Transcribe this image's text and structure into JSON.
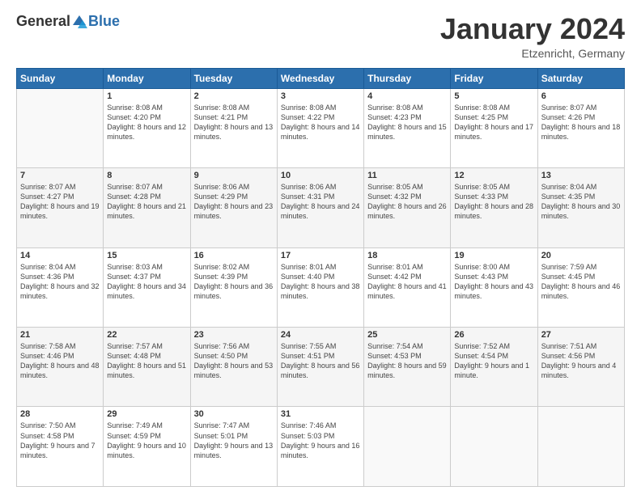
{
  "logo": {
    "general": "General",
    "blue": "Blue"
  },
  "header": {
    "month": "January 2024",
    "location": "Etzenricht, Germany"
  },
  "days_of_week": [
    "Sunday",
    "Monday",
    "Tuesday",
    "Wednesday",
    "Thursday",
    "Friday",
    "Saturday"
  ],
  "weeks": [
    [
      {
        "num": "",
        "sunrise": "",
        "sunset": "",
        "daylight": ""
      },
      {
        "num": "1",
        "sunrise": "Sunrise: 8:08 AM",
        "sunset": "Sunset: 4:20 PM",
        "daylight": "Daylight: 8 hours and 12 minutes."
      },
      {
        "num": "2",
        "sunrise": "Sunrise: 8:08 AM",
        "sunset": "Sunset: 4:21 PM",
        "daylight": "Daylight: 8 hours and 13 minutes."
      },
      {
        "num": "3",
        "sunrise": "Sunrise: 8:08 AM",
        "sunset": "Sunset: 4:22 PM",
        "daylight": "Daylight: 8 hours and 14 minutes."
      },
      {
        "num": "4",
        "sunrise": "Sunrise: 8:08 AM",
        "sunset": "Sunset: 4:23 PM",
        "daylight": "Daylight: 8 hours and 15 minutes."
      },
      {
        "num": "5",
        "sunrise": "Sunrise: 8:08 AM",
        "sunset": "Sunset: 4:25 PM",
        "daylight": "Daylight: 8 hours and 17 minutes."
      },
      {
        "num": "6",
        "sunrise": "Sunrise: 8:07 AM",
        "sunset": "Sunset: 4:26 PM",
        "daylight": "Daylight: 8 hours and 18 minutes."
      }
    ],
    [
      {
        "num": "7",
        "sunrise": "Sunrise: 8:07 AM",
        "sunset": "Sunset: 4:27 PM",
        "daylight": "Daylight: 8 hours and 19 minutes."
      },
      {
        "num": "8",
        "sunrise": "Sunrise: 8:07 AM",
        "sunset": "Sunset: 4:28 PM",
        "daylight": "Daylight: 8 hours and 21 minutes."
      },
      {
        "num": "9",
        "sunrise": "Sunrise: 8:06 AM",
        "sunset": "Sunset: 4:29 PM",
        "daylight": "Daylight: 8 hours and 23 minutes."
      },
      {
        "num": "10",
        "sunrise": "Sunrise: 8:06 AM",
        "sunset": "Sunset: 4:31 PM",
        "daylight": "Daylight: 8 hours and 24 minutes."
      },
      {
        "num": "11",
        "sunrise": "Sunrise: 8:05 AM",
        "sunset": "Sunset: 4:32 PM",
        "daylight": "Daylight: 8 hours and 26 minutes."
      },
      {
        "num": "12",
        "sunrise": "Sunrise: 8:05 AM",
        "sunset": "Sunset: 4:33 PM",
        "daylight": "Daylight: 8 hours and 28 minutes."
      },
      {
        "num": "13",
        "sunrise": "Sunrise: 8:04 AM",
        "sunset": "Sunset: 4:35 PM",
        "daylight": "Daylight: 8 hours and 30 minutes."
      }
    ],
    [
      {
        "num": "14",
        "sunrise": "Sunrise: 8:04 AM",
        "sunset": "Sunset: 4:36 PM",
        "daylight": "Daylight: 8 hours and 32 minutes."
      },
      {
        "num": "15",
        "sunrise": "Sunrise: 8:03 AM",
        "sunset": "Sunset: 4:37 PM",
        "daylight": "Daylight: 8 hours and 34 minutes."
      },
      {
        "num": "16",
        "sunrise": "Sunrise: 8:02 AM",
        "sunset": "Sunset: 4:39 PM",
        "daylight": "Daylight: 8 hours and 36 minutes."
      },
      {
        "num": "17",
        "sunrise": "Sunrise: 8:01 AM",
        "sunset": "Sunset: 4:40 PM",
        "daylight": "Daylight: 8 hours and 38 minutes."
      },
      {
        "num": "18",
        "sunrise": "Sunrise: 8:01 AM",
        "sunset": "Sunset: 4:42 PM",
        "daylight": "Daylight: 8 hours and 41 minutes."
      },
      {
        "num": "19",
        "sunrise": "Sunrise: 8:00 AM",
        "sunset": "Sunset: 4:43 PM",
        "daylight": "Daylight: 8 hours and 43 minutes."
      },
      {
        "num": "20",
        "sunrise": "Sunrise: 7:59 AM",
        "sunset": "Sunset: 4:45 PM",
        "daylight": "Daylight: 8 hours and 46 minutes."
      }
    ],
    [
      {
        "num": "21",
        "sunrise": "Sunrise: 7:58 AM",
        "sunset": "Sunset: 4:46 PM",
        "daylight": "Daylight: 8 hours and 48 minutes."
      },
      {
        "num": "22",
        "sunrise": "Sunrise: 7:57 AM",
        "sunset": "Sunset: 4:48 PM",
        "daylight": "Daylight: 8 hours and 51 minutes."
      },
      {
        "num": "23",
        "sunrise": "Sunrise: 7:56 AM",
        "sunset": "Sunset: 4:50 PM",
        "daylight": "Daylight: 8 hours and 53 minutes."
      },
      {
        "num": "24",
        "sunrise": "Sunrise: 7:55 AM",
        "sunset": "Sunset: 4:51 PM",
        "daylight": "Daylight: 8 hours and 56 minutes."
      },
      {
        "num": "25",
        "sunrise": "Sunrise: 7:54 AM",
        "sunset": "Sunset: 4:53 PM",
        "daylight": "Daylight: 8 hours and 59 minutes."
      },
      {
        "num": "26",
        "sunrise": "Sunrise: 7:52 AM",
        "sunset": "Sunset: 4:54 PM",
        "daylight": "Daylight: 9 hours and 1 minute."
      },
      {
        "num": "27",
        "sunrise": "Sunrise: 7:51 AM",
        "sunset": "Sunset: 4:56 PM",
        "daylight": "Daylight: 9 hours and 4 minutes."
      }
    ],
    [
      {
        "num": "28",
        "sunrise": "Sunrise: 7:50 AM",
        "sunset": "Sunset: 4:58 PM",
        "daylight": "Daylight: 9 hours and 7 minutes."
      },
      {
        "num": "29",
        "sunrise": "Sunrise: 7:49 AM",
        "sunset": "Sunset: 4:59 PM",
        "daylight": "Daylight: 9 hours and 10 minutes."
      },
      {
        "num": "30",
        "sunrise": "Sunrise: 7:47 AM",
        "sunset": "Sunset: 5:01 PM",
        "daylight": "Daylight: 9 hours and 13 minutes."
      },
      {
        "num": "31",
        "sunrise": "Sunrise: 7:46 AM",
        "sunset": "Sunset: 5:03 PM",
        "daylight": "Daylight: 9 hours and 16 minutes."
      },
      {
        "num": "",
        "sunrise": "",
        "sunset": "",
        "daylight": ""
      },
      {
        "num": "",
        "sunrise": "",
        "sunset": "",
        "daylight": ""
      },
      {
        "num": "",
        "sunrise": "",
        "sunset": "",
        "daylight": ""
      }
    ]
  ]
}
